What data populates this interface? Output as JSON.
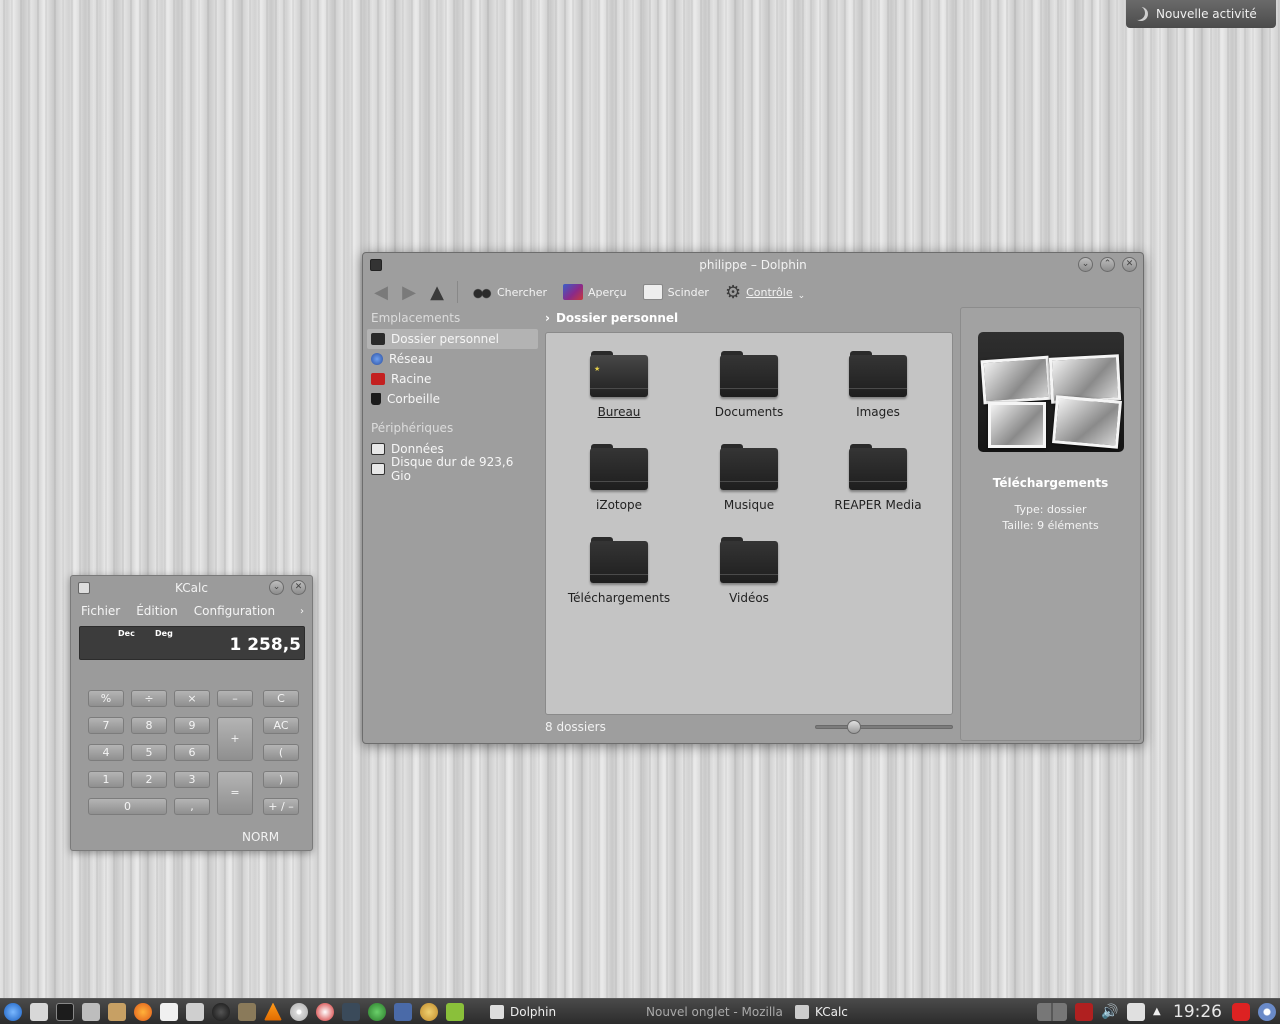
{
  "activity": {
    "label": "Nouvelle activité"
  },
  "dolphin": {
    "title": "philippe – Dolphin",
    "toolbar": {
      "search": "Chercher",
      "preview": "Aperçu",
      "split": "Scinder",
      "control": "Contrôle"
    },
    "sidebar": {
      "places_header": "Emplacements",
      "places": [
        {
          "label": "Dossier personnel",
          "color": "#2a2a2a"
        },
        {
          "label": "Réseau",
          "color": "#3a6bc4"
        },
        {
          "label": "Racine",
          "color": "#c42020"
        },
        {
          "label": "Corbeille",
          "color": "#1c1c1c"
        }
      ],
      "devices_header": "Périphériques",
      "devices": [
        {
          "label": "Données"
        },
        {
          "label": "Disque dur de 923,6 Gio"
        }
      ]
    },
    "breadcrumb": "Dossier personnel",
    "files": [
      {
        "label": "Bureau"
      },
      {
        "label": "Documents"
      },
      {
        "label": "Images"
      },
      {
        "label": "iZotope"
      },
      {
        "label": "Musique"
      },
      {
        "label": "REAPER Media"
      },
      {
        "label": "Téléchargements"
      },
      {
        "label": "Vidéos"
      }
    ],
    "status": "8 dossiers",
    "zoom_fraction": 0.25,
    "info": {
      "name": "Téléchargements",
      "type_label": "Type:",
      "type_value": "dossier",
      "size_label": "Taille:",
      "size_value": "9 éléments"
    }
  },
  "kcalc": {
    "title": "KCalc",
    "menu": [
      "Fichier",
      "Édition",
      "Configuration"
    ],
    "display": {
      "base": "Dec",
      "angle": "Deg",
      "value": "1 258,5"
    },
    "keys": [
      "%",
      "÷",
      "×",
      "–",
      "C",
      "7",
      "8",
      "9",
      "+",
      "AC",
      "4",
      "5",
      "6",
      "(",
      "1",
      "2",
      "3",
      "=",
      ")",
      "0",
      ",",
      "+ / –"
    ],
    "mode": "NORM"
  },
  "taskbar": {
    "tasks": [
      {
        "label": "Dolphin"
      },
      {
        "label": "Nouvel onglet - Mozilla"
      },
      {
        "label": "KCalc"
      }
    ],
    "clock": "19:26"
  }
}
